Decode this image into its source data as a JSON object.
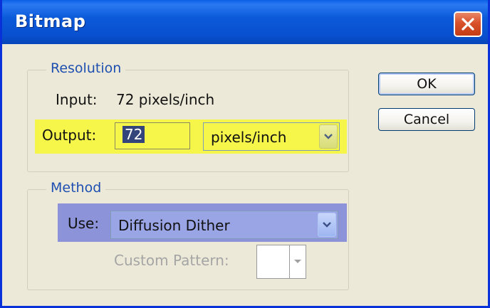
{
  "window": {
    "title": "Bitmap",
    "close_icon": "close-icon"
  },
  "resolution": {
    "legend": "Resolution",
    "input_label": "Input:",
    "input_value": "72 pixels/inch",
    "output_label": "Output:",
    "output_value": "72",
    "output_unit": "pixels/inch"
  },
  "method": {
    "legend": "Method",
    "use_label": "Use:",
    "use_value": "Diffusion Dither",
    "custom_pattern_label": "Custom Pattern:"
  },
  "buttons": {
    "ok": "OK",
    "cancel": "Cancel"
  },
  "colors": {
    "title_bar": "#0a5fe6",
    "output_highlight": "#f5f54a",
    "use_highlight": "#8c93d8",
    "legend_text": "#1e4fb0"
  }
}
